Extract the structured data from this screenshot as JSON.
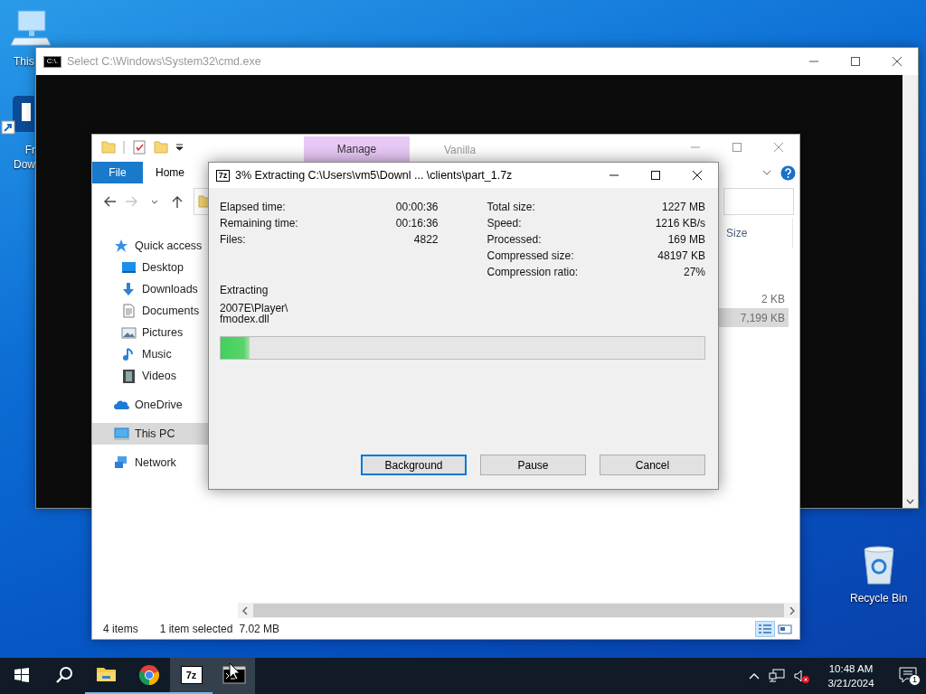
{
  "desktop_icons": [
    {
      "kind": "computer",
      "lines": [
        "This"
      ]
    },
    {
      "kind": "shortcut",
      "lines": [
        "Fr",
        "Dow"
      ]
    },
    {
      "kind": "recycle-bin",
      "lines": [
        "Recycle Bin"
      ]
    }
  ],
  "cmd_window": {
    "logo": "C:\\.",
    "title": "Select C:\\Windows\\System32\\cmd.exe"
  },
  "explorer": {
    "context_tab": "Manage",
    "title": "Vanilla",
    "ribbon_tabs": [
      {
        "label": "File",
        "kind": "menu"
      },
      {
        "label": "Home",
        "kind": "tab"
      }
    ],
    "nav": [
      {
        "kind": "back",
        "disabled": false
      },
      {
        "kind": "forward",
        "disabled": true
      },
      {
        "kind": "recent",
        "disabled": false
      },
      {
        "kind": "up",
        "disabled": false
      }
    ],
    "sidebar": [
      {
        "label": "Quick access",
        "kind": "star",
        "selected": false,
        "children": [
          {
            "label": "Desktop",
            "kind": "desktop",
            "selected": false
          },
          {
            "label": "Downloads",
            "kind": "download",
            "selected": false
          },
          {
            "label": "Documents",
            "kind": "document",
            "selected": false
          },
          {
            "label": "Pictures",
            "kind": "picture",
            "selected": false
          },
          {
            "label": "Music",
            "kind": "music",
            "selected": false
          },
          {
            "label": "Videos",
            "kind": "video",
            "selected": false
          }
        ]
      },
      {
        "label": "OneDrive",
        "kind": "cloud",
        "selected": false
      },
      {
        "label": "This PC",
        "kind": "pc",
        "selected": true
      },
      {
        "label": "Network",
        "kind": "network",
        "selected": false
      }
    ],
    "columns": [
      "Size"
    ],
    "rows": [
      {
        "size": "2 KB",
        "selected": false
      },
      {
        "size": "7,199 KB",
        "selected": true
      }
    ],
    "status": {
      "count": "4 items",
      "selection": "1 item selected",
      "size": "7.02 MB"
    },
    "views": [
      {
        "kind": "details",
        "selected": true
      },
      {
        "kind": "tiles",
        "selected": false
      }
    ]
  },
  "dialog": {
    "logo": "7z",
    "title": "3% Extracting C:\\Users\\vm5\\Downl ... \\clients\\part_1.7z",
    "stats_left": [
      {
        "label": "Elapsed time:",
        "value": "00:00:36"
      },
      {
        "label": "Remaining time:",
        "value": "00:16:36"
      },
      {
        "label": "Files:",
        "value": "4822"
      }
    ],
    "stats_right": [
      {
        "label": "Total size:",
        "value": "1227 MB"
      },
      {
        "label": "Speed:",
        "value": "1216 KB/s"
      },
      {
        "label": "Processed:",
        "value": "169 MB"
      },
      {
        "label": "Compressed size:",
        "value": "48197 KB"
      },
      {
        "label": "Compression ratio:",
        "value": "27%"
      }
    ],
    "action": "Extracting",
    "current_file": [
      "2007E\\Player\\",
      "fmodex.dll"
    ],
    "progress": {
      "level": 0.06
    },
    "buttons": [
      {
        "label": "Background",
        "default": true
      },
      {
        "label": "Pause",
        "default": false
      },
      {
        "label": "Cancel",
        "default": false
      }
    ]
  },
  "taskbar": {
    "apps": [
      {
        "kind": "explorer",
        "running": true,
        "selected": false
      },
      {
        "kind": "chrome",
        "running": true,
        "selected": false
      },
      {
        "kind": "sevenzip",
        "logo": "7z",
        "running": true,
        "selected": true
      },
      {
        "kind": "cmd",
        "running": false,
        "selected": true
      }
    ],
    "clock": {
      "time": "10:48 AM",
      "date": "3/21/2024"
    },
    "notification_count": "1"
  }
}
